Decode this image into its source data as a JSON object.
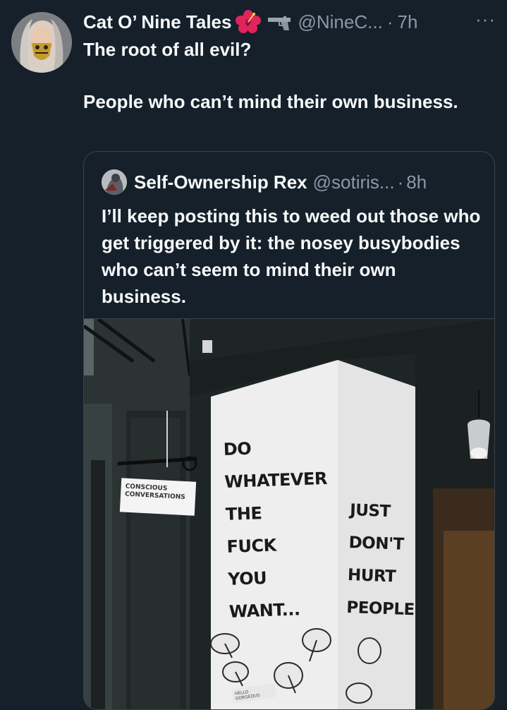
{
  "tweet": {
    "author_name": "Cat O’ Nine Tales",
    "handle": "@NineC...",
    "separator": "·",
    "time": "7h",
    "more_label": "···",
    "text_line1": "The root of all evil?",
    "text_line2": "People who can’t mind their own business.",
    "emoji_icons": [
      "hibiscus-icon",
      "pistol-icon"
    ]
  },
  "quoted": {
    "author_name": "Self-Ownership Rex",
    "handle": "@sotiris...",
    "separator": "·",
    "time": "8h",
    "text": "I’ll keep posting this to weed out those who get triggered by it: the nosey busybodies who can’t seem to mind their own business."
  },
  "photo": {
    "hanging_sign_line1": "CONSCIOUS",
    "hanging_sign_line2": "CONVERSATIONS",
    "wall_left": [
      "DO",
      "WHATEVER",
      "THE",
      "FUCK",
      "YOU",
      "WANT..."
    ],
    "wall_right": [
      "JUST",
      "DON'T",
      "HURT",
      "PEOPLE"
    ],
    "small_sign": "HELLO GORGEOUS"
  },
  "colors": {
    "background": "#15202b",
    "text": "#f7f9f9",
    "muted": "#8b98a5",
    "border": "#38444d"
  }
}
